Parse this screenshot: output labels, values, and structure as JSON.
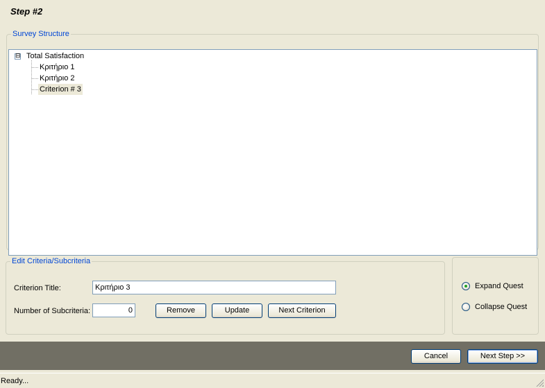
{
  "page": {
    "step_title": "Step #2"
  },
  "survey_structure": {
    "legend": "Survey Structure",
    "tree": {
      "expander_symbol": "⊟",
      "root": "Total Satisfaction",
      "children": [
        "Κριτήριο 1",
        "Κριτήριο 2",
        "Criterion # 3"
      ],
      "selected_index": 2
    }
  },
  "edit_criteria": {
    "legend": "Edit Criteria/Subcriteria",
    "criterion_title_label": "Criterion Title:",
    "criterion_title_value": "Κριτήριο 3",
    "num_subcriteria_label": "Number of Subcriteria:",
    "num_subcriteria_value": "0",
    "remove_label": "Remove",
    "update_label": "Update",
    "next_criterion_label": "Next Criterion"
  },
  "view_options": {
    "expand_label": "Expand Quest",
    "collapse_label": "Collapse Quest",
    "selected": "expand"
  },
  "footer": {
    "cancel_label": "Cancel",
    "next_step_label": "Next Step >>"
  },
  "status": {
    "text": "Ready..."
  },
  "colors": {
    "background": "#ece9d8",
    "legend": "#0046d5",
    "footer_bar": "#716f64",
    "selection": "#ece9d8"
  }
}
